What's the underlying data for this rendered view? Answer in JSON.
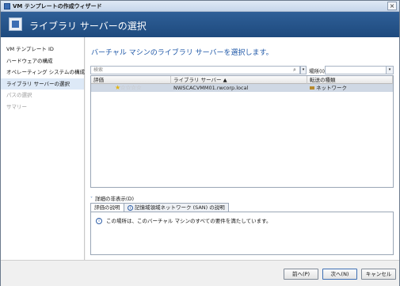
{
  "window": {
    "title": "VM テンプレートの作成ウィザード",
    "close_glyph": "×"
  },
  "header": {
    "title": "ライブラリ サーバーの選択"
  },
  "sidebar": {
    "items": [
      {
        "label": "VM テンプレート ID"
      },
      {
        "label": "ハードウェアの構成"
      },
      {
        "label": "オペレーティング システムの構成"
      },
      {
        "label": "ライブラリ サーバーの選択"
      },
      {
        "label": "パスの選択"
      },
      {
        "label": "サマリー"
      }
    ]
  },
  "main": {
    "heading": "バーチャル マシンのライブラリ サーバーを選択します。",
    "search": {
      "placeholder": "検索",
      "button_glyph": "⌕",
      "dropdown_glyph": "▾"
    },
    "location": {
      "label": "場所(I)",
      "value": "",
      "arrow_glyph": "▾"
    },
    "grid": {
      "columns": [
        "評価",
        "ライブラリ サーバー ▲",
        "転送の種類"
      ],
      "rows": [
        {
          "rating_glyphs_on": "★",
          "rating_glyphs_off": "☆☆☆☆",
          "rating": 1,
          "server": "NWSCACVMM01.rwcorp.local",
          "transfer": "ネットワーク"
        }
      ]
    },
    "details_toggle": {
      "chevron": "˅",
      "label": "詳細の非表示(D)"
    },
    "tabs": [
      {
        "label": "評価の説明"
      },
      {
        "info_glyph": "i",
        "label": "記憶域領域ネットワーク (SAN) の説明"
      }
    ],
    "details": {
      "info_glyph": "i",
      "message": "この場所は、このバーチャル マシンのすべての要件を満たしています。"
    }
  },
  "footer": {
    "back_label": "前へ(P)",
    "next_label": "次へ(N)",
    "cancel_label": "キャンセル"
  },
  "colors": {
    "header_bg": "#1e4a7e",
    "heading_text": "#1f58a8",
    "selection_row": "#cfd8e4",
    "star_on": "#e2b30f",
    "star_off": "#c4c4c4"
  }
}
